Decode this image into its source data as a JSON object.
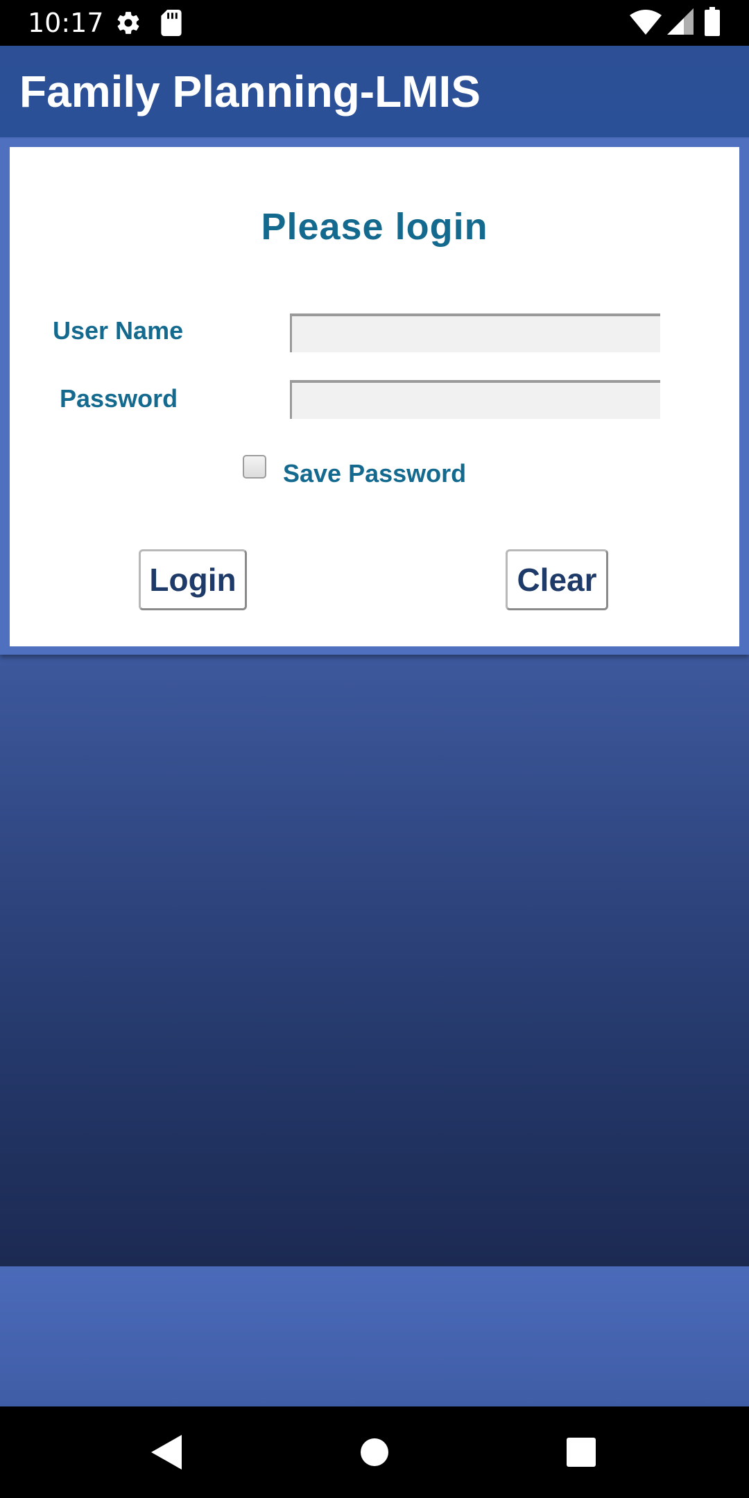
{
  "status_bar": {
    "time": "10:17",
    "icons": [
      "gear-icon",
      "sd-card-icon",
      "wifi-icon",
      "signal-icon",
      "battery-icon"
    ]
  },
  "app_bar": {
    "title": "Family Planning-LMIS"
  },
  "login": {
    "heading": "Please login",
    "username_label": "User Name",
    "username_value": "",
    "password_label": "Password",
    "password_value": "",
    "save_password_label": "Save Password",
    "save_password_checked": false,
    "login_button": "Login",
    "clear_button": "Clear"
  },
  "nav_bar": {
    "buttons": [
      "back-icon",
      "home-icon",
      "recents-icon"
    ]
  },
  "colors": {
    "app_bar": "#2c4f95",
    "label_text": "#146a8e",
    "button_text": "#1e3a68",
    "background_top": "#4f6fbf",
    "background_bottom": "#1c2a52"
  }
}
